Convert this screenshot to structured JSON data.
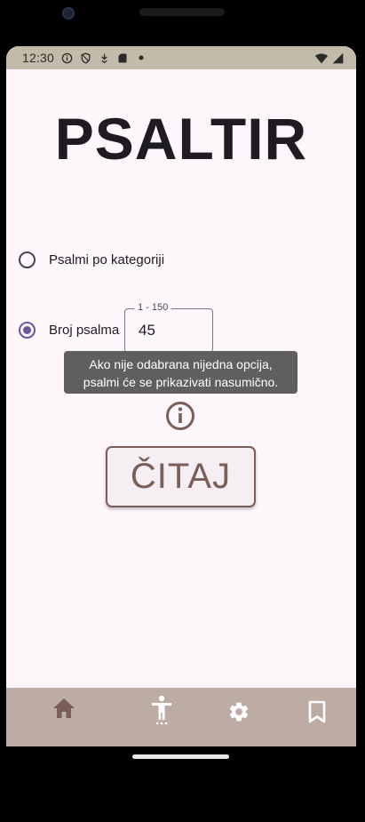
{
  "status_bar": {
    "time": "12:30",
    "icons_left": [
      "info-circle-icon",
      "shield-icon",
      "download-icon",
      "sd-card-icon",
      "dot-icon"
    ],
    "icons_right": [
      "wifi-icon",
      "cellular-signal-icon"
    ]
  },
  "app": {
    "title": "PSALTIR"
  },
  "options": [
    {
      "label": "Psalmi po kategoriji",
      "selected": false
    },
    {
      "label": "Broj psalma",
      "selected": true
    }
  ],
  "psalm_number_field": {
    "legend": "1 - 150",
    "value": "45"
  },
  "tooltip": {
    "line1": "Ako nije odabrana nijedna opcija,",
    "line2": "psalmi će se prikazivati nasumično."
  },
  "read_button": {
    "label": "ČITAJ"
  },
  "bottom_nav": {
    "items": [
      {
        "icon": "home-icon",
        "active": true
      },
      {
        "icon": "accessibility-icon",
        "active": false
      },
      {
        "icon": "settings-icon",
        "active": false
      },
      {
        "icon": "bookmark-icon",
        "active": false
      }
    ]
  },
  "colors": {
    "accent": "#6b55a0",
    "brand_brown": "#7b5e57",
    "nav_background": "#bcaca3",
    "status_bar": "#c2bba9",
    "screen_background": "#fdf6fb"
  }
}
